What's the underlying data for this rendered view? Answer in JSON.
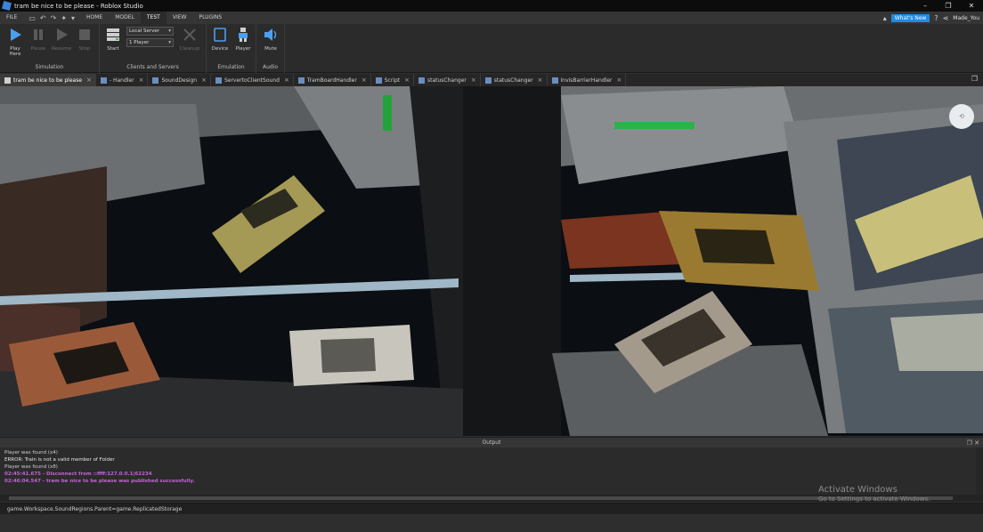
{
  "window": {
    "title": "tram be nice to be please - Roblox Studio",
    "controls": [
      "–",
      "❐",
      "✕"
    ]
  },
  "menu": {
    "items": [
      "FILE",
      "HOME",
      "MODEL",
      "TEST",
      "VIEW",
      "PLUGINS"
    ],
    "active": "TEST",
    "whats_new": "What's New",
    "user": "Made_You"
  },
  "ribbon": {
    "simulation": {
      "label": "Simulation",
      "play": "Play Here",
      "pause": "Pause",
      "resume": "Resume",
      "stop": "Stop"
    },
    "clients_servers": {
      "label": "Clients and Servers",
      "start": "Start",
      "mode": "Local Server",
      "players": "1 Player",
      "cleanup": "Cleanup"
    },
    "emulation": {
      "label": "Emulation",
      "device": "Device",
      "player": "Player"
    },
    "audio": {
      "label": "Audio",
      "mute": "Mute"
    }
  },
  "tabs": [
    {
      "label": "tram be nice to be please",
      "active": true
    },
    {
      "label": "- Handler"
    },
    {
      "label": "SoundDesign"
    },
    {
      "label": "ServertoClientSound"
    },
    {
      "label": "TramBoardHandler"
    },
    {
      "label": "Script"
    },
    {
      "label": "statusChanger"
    },
    {
      "label": "statusChanger"
    },
    {
      "label": "InvisBarrierHandler"
    }
  ],
  "output": {
    "title": "Output",
    "lines": [
      {
        "text": "Player was found (x4)",
        "kind": "normal"
      },
      {
        "text": "ERROR: Train is not a valid member of Folder",
        "kind": "err"
      },
      {
        "text": "Player was found (x8)",
        "kind": "normal"
      },
      {
        "text": "02:45:41.675 - Disconnect from ::ffff:127.0.0.1|62234",
        "kind": "info"
      },
      {
        "text": "02:46:04.547 - tram be nice to be please was published successfully.",
        "kind": "info"
      }
    ]
  },
  "command_bar": "game.Workspace.SoundRegions.Parent=game.ReplicatedStorage",
  "watermark": {
    "line1": "Activate Windows",
    "line2": "Go to Settings to activate Windows."
  },
  "colors": {
    "accent": "#1b8de0",
    "info": "#c264d6"
  }
}
